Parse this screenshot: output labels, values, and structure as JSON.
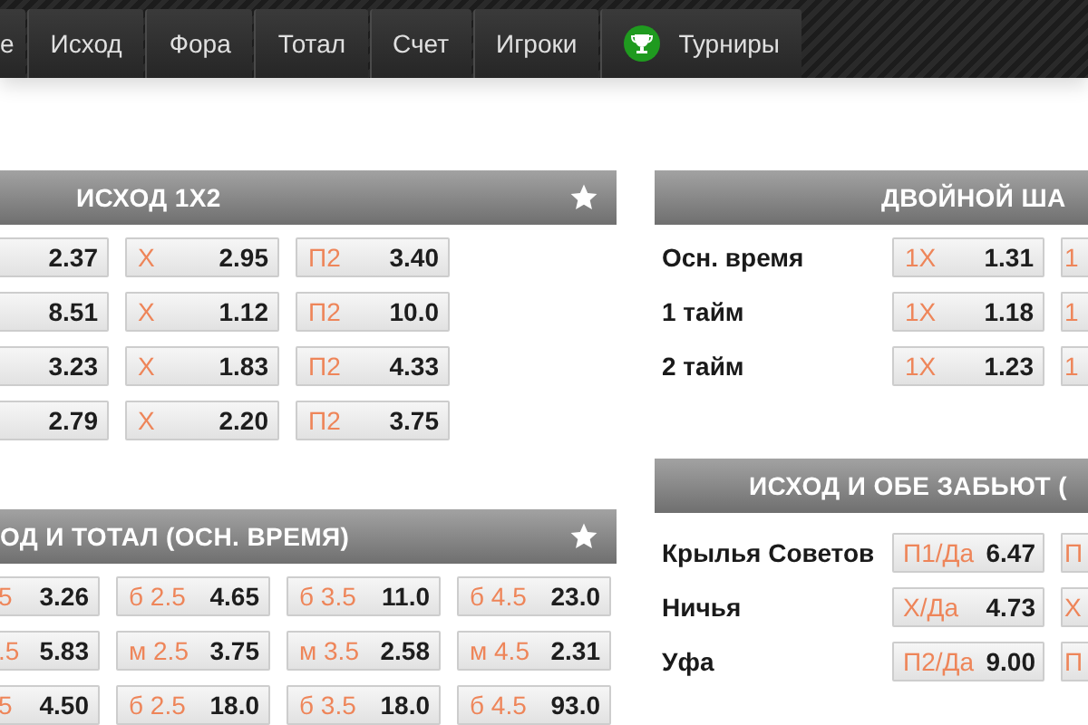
{
  "tabs": [
    {
      "label": "е",
      "selected": false,
      "kind": "plain"
    },
    {
      "label": "Исход",
      "selected": false,
      "kind": "plain"
    },
    {
      "label": "Фора",
      "selected": false,
      "kind": "plain"
    },
    {
      "label": "Тотал",
      "selected": false,
      "kind": "plain"
    },
    {
      "label": "Счет",
      "selected": false,
      "kind": "plain"
    },
    {
      "label": "Игроки",
      "selected": false,
      "kind": "plain"
    },
    {
      "label": "Турниры",
      "selected": false,
      "kind": "trophy"
    }
  ],
  "left_column": [
    {
      "title": "ИСХОД 1X2",
      "rows": [
        [
          {
            "value": "2.37"
          },
          {
            "label": "Х",
            "value": "2.95"
          },
          {
            "label": "П2",
            "value": "3.40"
          }
        ],
        [
          {
            "value": "8.51"
          },
          {
            "label": "Х",
            "value": "1.12"
          },
          {
            "label": "П2",
            "value": "10.0"
          }
        ],
        [
          {
            "value": "3.23"
          },
          {
            "label": "Х",
            "value": "1.83"
          },
          {
            "label": "П2",
            "value": "4.33"
          }
        ],
        [
          {
            "value": "2.79"
          },
          {
            "label": "Х",
            "value": "2.20"
          },
          {
            "label": "П2",
            "value": "3.75"
          }
        ]
      ]
    },
    {
      "title": "ОД И ТОТАЛ (ОСН. ВРЕМЯ)",
      "rows": [
        [
          {
            "label": "5",
            "value": "3.26"
          },
          {
            "label": "б 2.5",
            "value": "4.65"
          },
          {
            "label": "б 3.5",
            "value": "11.0"
          },
          {
            "label": "б 4.5",
            "value": "23.0"
          }
        ],
        [
          {
            "label": ".5",
            "value": "5.83"
          },
          {
            "label": "м 2.5",
            "value": "3.75"
          },
          {
            "label": "м 3.5",
            "value": "2.58"
          },
          {
            "label": "м 4.5",
            "value": "2.31"
          }
        ],
        [
          {
            "label": "5",
            "value": "4.50"
          },
          {
            "label": "б 2.5",
            "value": "18.0"
          },
          {
            "label": "б 3.5",
            "value": "18.0"
          },
          {
            "label": "б 4.5",
            "value": "93.0"
          }
        ]
      ]
    }
  ],
  "right_column": [
    {
      "title": "ДВОЙНОЙ ША",
      "rows": [
        {
          "label": "Осн. время",
          "cells": [
            {
              "label": "1X",
              "value": "1.31"
            },
            {
              "label": "1"
            }
          ]
        },
        {
          "label": "1 тайм",
          "cells": [
            {
              "label": "1X",
              "value": "1.18"
            },
            {
              "label": "1"
            }
          ]
        },
        {
          "label": "2 тайм",
          "cells": [
            {
              "label": "1X",
              "value": "1.23"
            },
            {
              "label": "1"
            }
          ]
        }
      ]
    },
    {
      "title": "ИСХОД И ОБЕ ЗАБЬЮТ (",
      "rows": [
        {
          "label": "Крылья Советов",
          "cells": [
            {
              "label": "П1/Да",
              "value": "6.47"
            },
            {
              "label": "П"
            }
          ]
        },
        {
          "label": "Ничья",
          "cells": [
            {
              "label": "Х/Да",
              "value": "4.73"
            },
            {
              "label": "Х"
            }
          ]
        },
        {
          "label": "Уфа",
          "cells": [
            {
              "label": "П2/Да",
              "value": "9.00"
            },
            {
              "label": "П"
            }
          ]
        }
      ]
    }
  ]
}
